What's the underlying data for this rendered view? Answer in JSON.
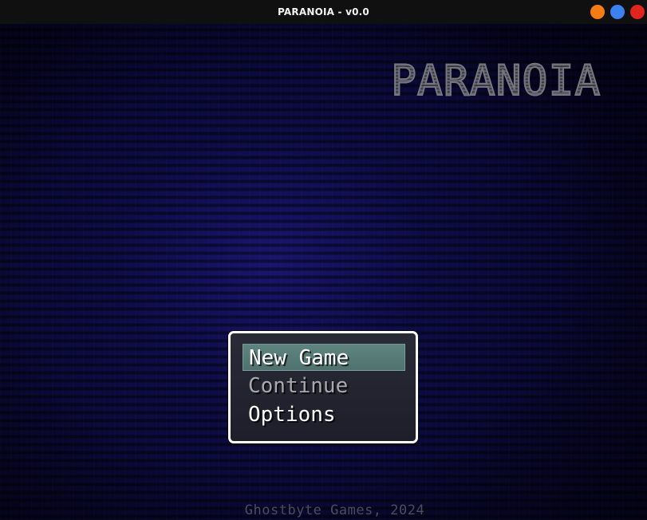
{
  "window": {
    "title": "PARANOIA - v0.0",
    "controls": {
      "minimize_color": "#f57c13",
      "maximize_color": "#3b82f0",
      "close_color": "#e0251f"
    }
  },
  "game": {
    "logo_text": "PARANOIA",
    "menu": {
      "items": [
        {
          "label": "New Game",
          "state": "selected"
        },
        {
          "label": "Continue",
          "state": "disabled"
        },
        {
          "label": "Options",
          "state": "normal"
        }
      ],
      "highlight_color": "#5b7f7b",
      "border_color": "#ffffff"
    },
    "footer_text": "Ghostbyte Games, 2024",
    "background_color": "#0a0a3a"
  }
}
